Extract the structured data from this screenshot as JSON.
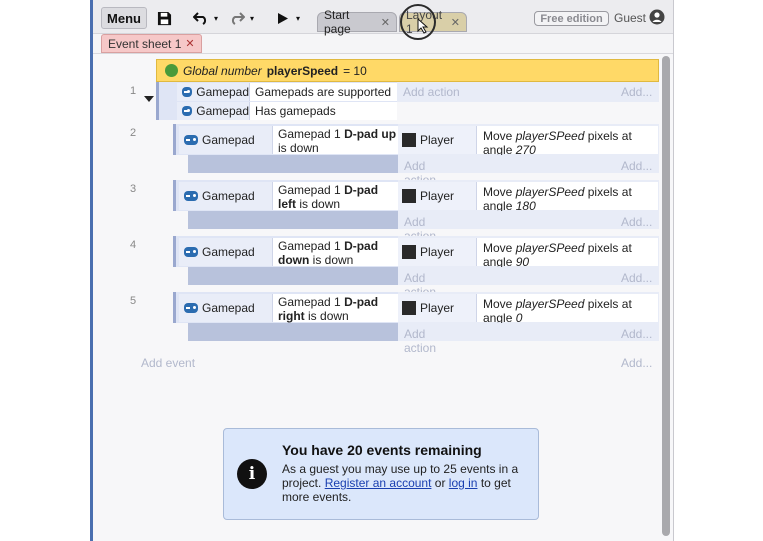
{
  "toolbar": {
    "menu_label": "Menu",
    "tabs": [
      {
        "label": "Start page"
      },
      {
        "label": "Layout 1"
      }
    ],
    "free_edition": "Free edition",
    "guest": "Guest"
  },
  "sheet_tab": {
    "label": "Event sheet 1"
  },
  "global_var": {
    "prefix": "Global number",
    "name": "playerSpeed",
    "value": "= 10"
  },
  "events": [
    {
      "number": "1",
      "conditions": [
        {
          "object": "Gamepad",
          "text": "Gamepads are supported"
        },
        {
          "object": "Gamepad",
          "text": "Has gamepads"
        }
      ],
      "add_action": "Add action",
      "add_more": "Add..."
    },
    {
      "number": "2",
      "condition": {
        "object": "Gamepad",
        "pre": "Gamepad 1",
        "bold": "D-pad up",
        "post": "is down"
      },
      "action": {
        "object": "Player",
        "pre": "Move",
        "var": "playerSPeed",
        "mid": "pixels at angle",
        "angle": "270"
      },
      "add_action": "Add action",
      "add_more": "Add..."
    },
    {
      "number": "3",
      "condition": {
        "object": "Gamepad",
        "pre": "Gamepad 1",
        "bold": "D-pad left",
        "post": "is down"
      },
      "action": {
        "object": "Player",
        "pre": "Move",
        "var": "playerSPeed",
        "mid": "pixels at angle",
        "angle": "180"
      },
      "add_action": "Add action",
      "add_more": "Add..."
    },
    {
      "number": "4",
      "condition": {
        "object": "Gamepad",
        "pre": "Gamepad 1",
        "bold": "D-pad down",
        "post": "is down"
      },
      "action": {
        "object": "Player",
        "pre": "Move",
        "var": "playerSPeed",
        "mid": "pixels at angle",
        "angle": "90"
      },
      "add_action": "Add action",
      "add_more": "Add..."
    },
    {
      "number": "5",
      "condition": {
        "object": "Gamepad",
        "pre": "Gamepad 1",
        "bold": "D-pad right",
        "post": "is down"
      },
      "action": {
        "object": "Player",
        "pre": "Move",
        "var": "playerSPeed",
        "mid": "pixels at angle",
        "angle": "0"
      },
      "add_action": "Add action",
      "add_more": "Add..."
    }
  ],
  "add_event": "Add event",
  "add_event_more": "Add...",
  "notice": {
    "title": "You have 20 events remaining",
    "body_pre": "As a guest you may use up to 25 events in a project.",
    "register_link": "Register an account",
    "or": "or",
    "login_link": "log in",
    "body_post": "to get more events."
  },
  "icons": {
    "menu_save": "save-icon",
    "undo": "undo-icon",
    "redo": "redo-icon",
    "play": "play-icon",
    "gamepad": "gamepad-icon",
    "globe": "globe-icon",
    "info": "info-icon",
    "guest_avatar": "user-avatar-icon"
  },
  "colors": {
    "global_var_bg": "#ffd967",
    "event_bg": "#dfe5f5",
    "notice_bg": "#dbe7fb",
    "link": "#1a3fb0"
  }
}
